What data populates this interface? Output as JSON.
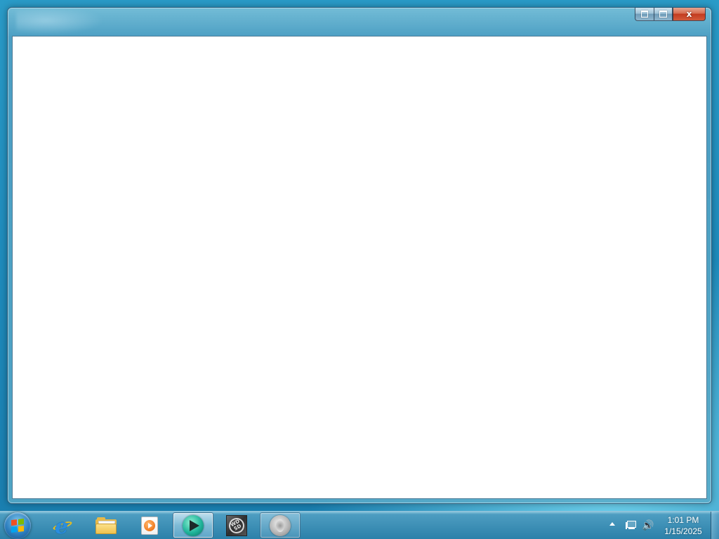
{
  "window": {
    "caption_buttons": {
      "restore_icon": "restore-icon",
      "maximize_icon": "maximize-icon",
      "close_label": "x"
    }
  },
  "taskbar": {
    "start_icon": "windows-start-orb",
    "pinned": [
      {
        "name": "internet-explorer",
        "icon": "ie-icon",
        "state": "pinned"
      },
      {
        "name": "file-explorer",
        "icon": "folder-icon",
        "state": "pinned"
      },
      {
        "name": "media-player",
        "icon": "media-player-icon",
        "state": "pinned"
      },
      {
        "name": "teal-media-app",
        "icon": "teal-play-icon",
        "state": "active"
      },
      {
        "name": "wd-app",
        "icon": "wd-badge-icon",
        "state": "pinned"
      },
      {
        "name": "speaker-app",
        "icon": "speaker-icon",
        "state": "open"
      }
    ],
    "wd_badge_text": "WD SD",
    "tray": {
      "chevron_icon": "show-hidden-icons",
      "network_icon": "network-icon",
      "volume_icon": "volume-icon",
      "time": "1:01 PM",
      "date": "1/15/2025"
    }
  },
  "colors": {
    "desktop": "#1f8cbd",
    "close_button": "#c23b1f",
    "window_client": "#ffffff"
  }
}
